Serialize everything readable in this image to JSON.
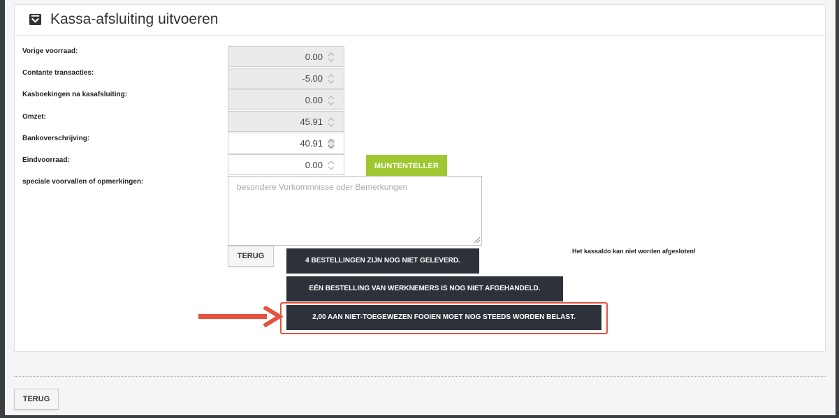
{
  "header": {
    "title": "Kassa-afsluiting uitvoeren",
    "icon": "cash-register-icon"
  },
  "form": {
    "fields": [
      {
        "label": "Vorige voorraad:",
        "value": "0.00",
        "readonly": true
      },
      {
        "label": "Contante transacties:",
        "value": "-5.00",
        "readonly": true
      },
      {
        "label": "Kasboekingen na kasafsluiting:",
        "value": "0.00",
        "readonly": true
      },
      {
        "label": "Omzet:",
        "value": "45.91",
        "readonly": true
      },
      {
        "label": "Bankoverschrijving:",
        "value": "40.91",
        "readonly": false
      },
      {
        "label": "Eindvoorraad:",
        "value": "0.00",
        "readonly": false
      }
    ],
    "remarks_label": "speciale voorvallen of opmerkingen:",
    "remarks_placeholder": "besondere Vorkommnisse oder Bemerkungen",
    "coin_counter_label": "MUNTENTELLER"
  },
  "actions": {
    "back_label": "TERUG",
    "messages": [
      "4 BESTELLINGEN ZIJN NOG NIET GELEVERD.",
      "EÉN BESTELLING VAN WERKNEMERS IS NOG NIET AFGEHANDELD.",
      "2,00 AAN NIET-TOEGEWEZEN FOOIEN MOET NOG STEEDS WORDEN BELAST."
    ],
    "notice": "Het kassaldo kan niet worden afgesloten!"
  },
  "footer": {
    "back_label": "TERUG"
  },
  "colors": {
    "accent_green": "#9fc730",
    "dark_button": "#2d3139",
    "highlight": "#e5533d"
  }
}
